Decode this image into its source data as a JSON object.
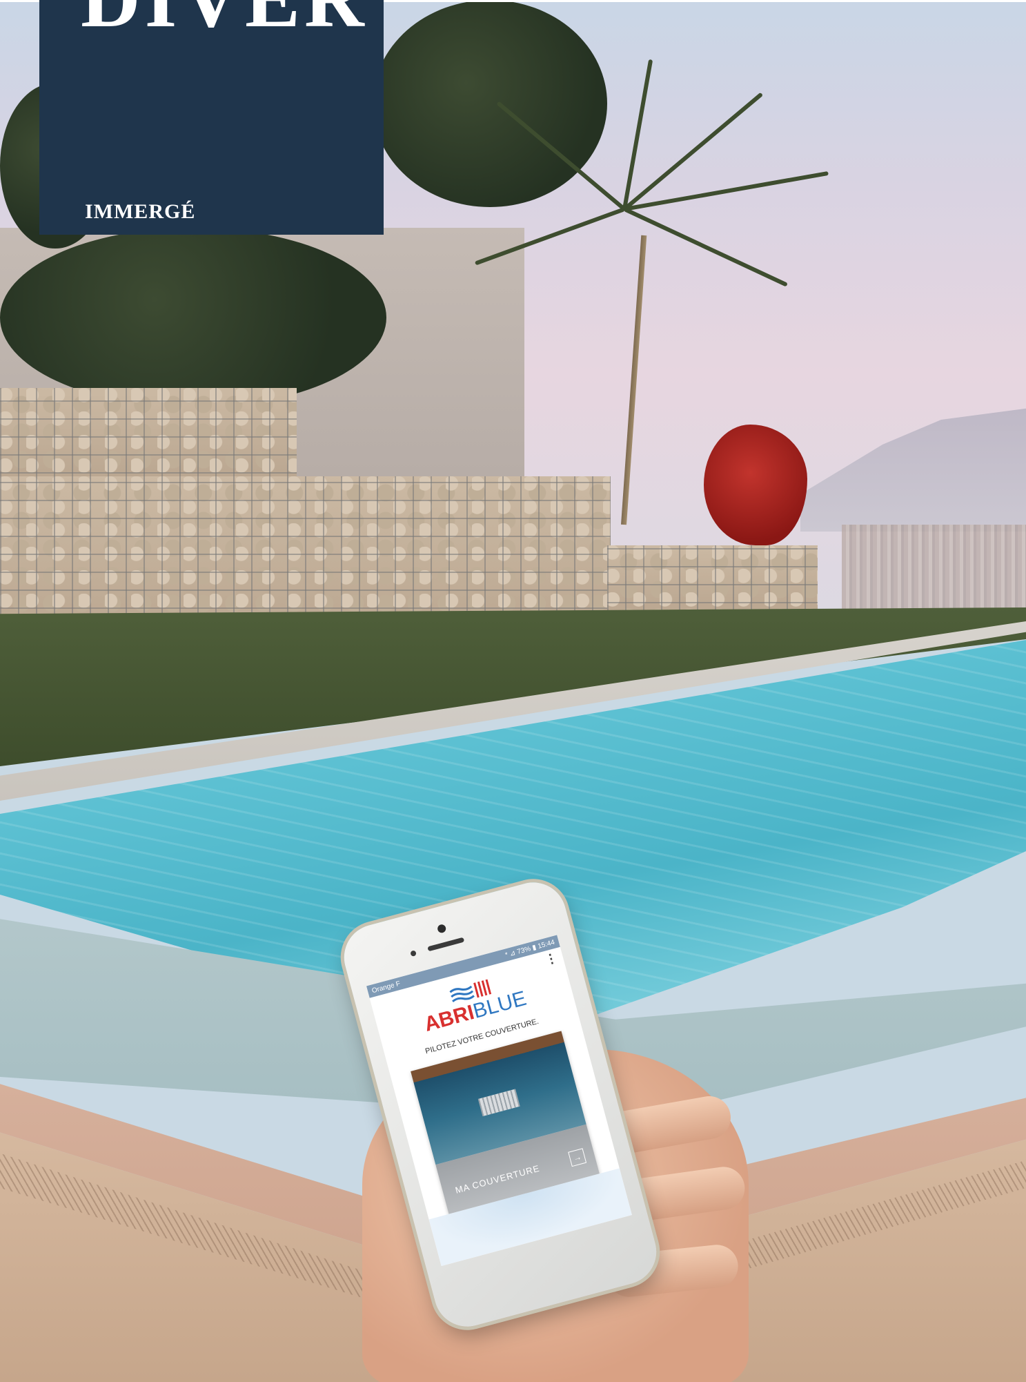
{
  "header": {
    "title_fragment": "DIVER",
    "subtitle": "IMMERGÉ"
  },
  "phone_app": {
    "carrier": "Orange F",
    "status_right": "* ⊿ 73% ▮ 15:44",
    "menu_icon": "more-vertical-icon",
    "brand_part1": "ABRI",
    "brand_part2": "BLUE",
    "tagline": "PILOTEZ VOTRE COUVERTURE.",
    "card_label": "MA COUVERTURE",
    "card_arrow": "→"
  },
  "colors": {
    "title_block": "#1f354c",
    "brand_red": "#d8302f",
    "brand_blue": "#2f77c1",
    "pool_water": "#5cc0d2"
  }
}
